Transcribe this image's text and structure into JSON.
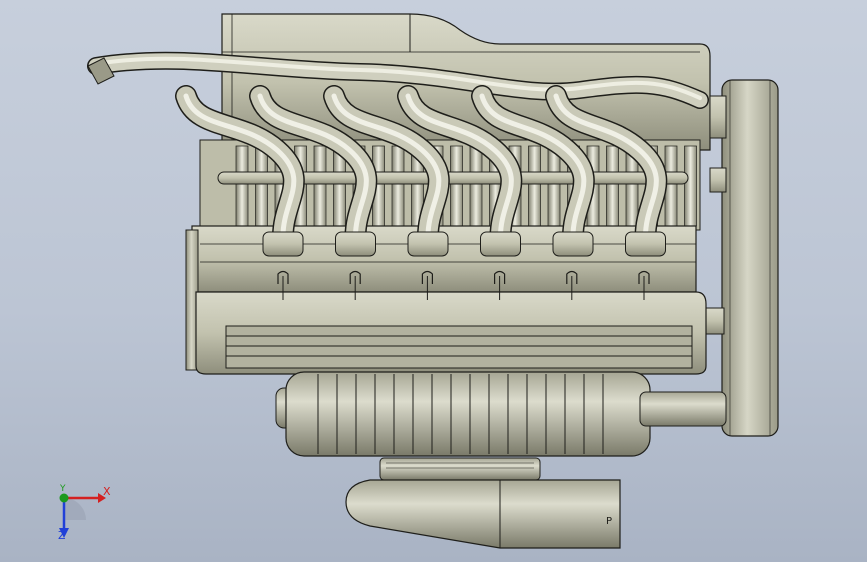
{
  "viewport": {
    "background_top": "#c7cfdc",
    "background_bottom": "#a9b3c4"
  },
  "model": {
    "description_icon": "v6-engine-assembly-icon",
    "body_color": "#c4c4b0",
    "edge_color": "#1e1e1a",
    "cylinders_per_bank": 6
  },
  "triad": {
    "x_label": "X",
    "y_label": "Y",
    "z_label": "Z",
    "x_color": "#d42020",
    "y_color": "#1d9a1d",
    "z_color": "#2140d8"
  },
  "marking": {
    "text": "P"
  }
}
